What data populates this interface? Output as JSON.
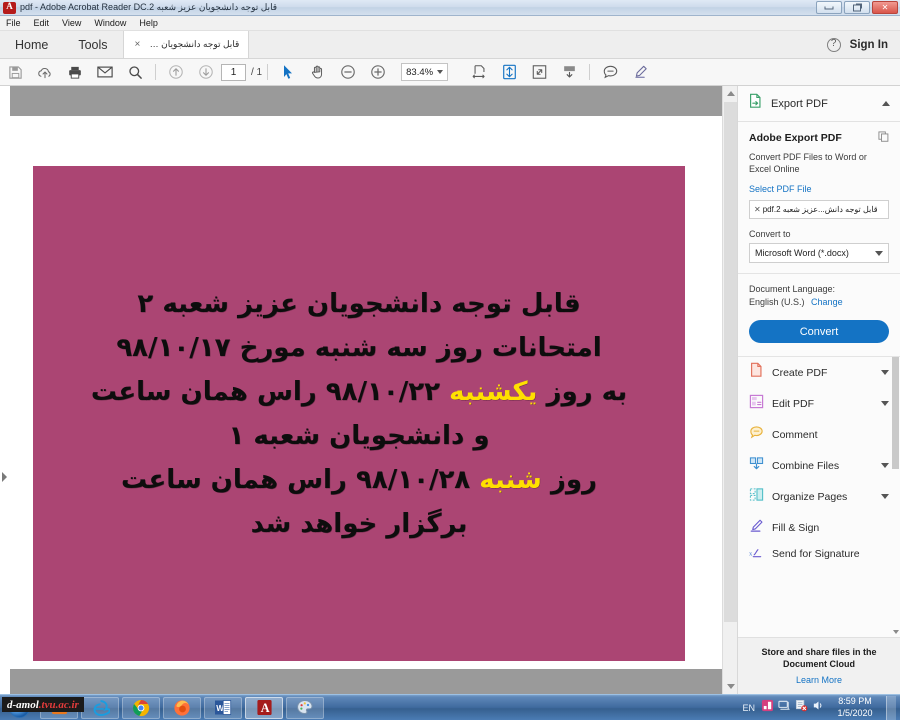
{
  "window": {
    "title": "قابل توجه دانشجویان عزیز شعبه 2.pdf - Adobe Acrobat Reader DC",
    "app_icon": "acrobat-icon",
    "minimize_label": "Minimize",
    "maximize_label": "Restore",
    "close_label": "Close"
  },
  "menubar": {
    "items": [
      {
        "label": "File"
      },
      {
        "label": "Edit"
      },
      {
        "label": "View"
      },
      {
        "label": "Window"
      },
      {
        "label": "Help"
      }
    ]
  },
  "tabbar": {
    "home_label": "Home",
    "tools_label": "Tools",
    "document_tab": "قابل توجه دانشجویان عز...",
    "document_tab_close": "×",
    "help_icon": "help-circle-icon",
    "signin_label": "Sign In"
  },
  "toolbar": {
    "save_label": "Save",
    "cloud_label": "Save to cloud",
    "print_label": "Print",
    "email_label": "Email",
    "search_label": "Find",
    "page_up_label": "Previous page",
    "page_down_label": "Next page",
    "page_current": "1",
    "page_total": "/ 1",
    "select_label": "Select tool",
    "hand_label": "Hand tool",
    "zoom_out_label": "Zoom out",
    "zoom_in_label": "Zoom in",
    "zoom_value": "83.4%",
    "fit_width_label": "Fit width",
    "fit_page_label": "Fit page",
    "fullscreen_label": "Zoom to page level",
    "scroll_mode_label": "Scroll mode",
    "comment_label": "Add comment",
    "highlight_label": "Highlight text"
  },
  "document": {
    "lines": [
      {
        "segments": [
          {
            "text": "قابل توجه دانشجویان عزیز شعبه ۲",
            "highlight": false
          }
        ]
      },
      {
        "segments": [
          {
            "text": "امتحانات روز سه شنبه مورخ ۹۸/۱۰/۱۷",
            "highlight": false
          }
        ]
      },
      {
        "segments": [
          {
            "text": "به روز ",
            "highlight": false
          },
          {
            "text": "یکشنبه",
            "highlight": true
          },
          {
            "text": " ۹۸/۱۰/۲۲ راس همان ساعت",
            "highlight": false
          }
        ]
      },
      {
        "segments": [
          {
            "text": "و دانشجویان شعبه ۱",
            "highlight": false
          }
        ]
      },
      {
        "segments": [
          {
            "text": "روز ",
            "highlight": false
          },
          {
            "text": "شنبه",
            "highlight": true
          },
          {
            "text": " ۹۸/۱۰/۲۸ راس همان ساعت",
            "highlight": false
          }
        ]
      },
      {
        "segments": [
          {
            "text": "برگزار خواهد شد",
            "highlight": false
          }
        ]
      }
    ],
    "background_color": "#ab4573",
    "text_color": "#0d0d0d",
    "highlight_color": "#ffe000"
  },
  "right_panel": {
    "header_title": "Export PDF",
    "header_icon": "export-pdf-icon",
    "collapse_icon": "chevron-up-icon",
    "export": {
      "heading": "Adobe Export PDF",
      "copy_icon": "copy-icon",
      "description": "Convert PDF Files to Word or Excel Online",
      "select_file_link": "Select PDF File",
      "file_chip": "قابل توجه دانش...عزیز شعبه 2.pdf",
      "file_chip_close": "✕",
      "convert_to_label": "Convert to",
      "convert_to_value": "Microsoft Word (*.docx)",
      "language_label": "Document Language:",
      "language_value": "English (U.S.)",
      "language_change_link": "Change",
      "convert_button": "Convert",
      "convert_button_color": "#1473c4"
    },
    "tools": [
      {
        "label": "Create PDF",
        "icon": "create-pdf-icon",
        "has_chevron": true
      },
      {
        "label": "Edit PDF",
        "icon": "edit-pdf-icon",
        "has_chevron": true
      },
      {
        "label": "Comment",
        "icon": "comment-icon",
        "has_chevron": false
      },
      {
        "label": "Combine Files",
        "icon": "combine-files-icon",
        "has_chevron": true
      },
      {
        "label": "Organize Pages",
        "icon": "organize-pages-icon",
        "has_chevron": true
      },
      {
        "label": "Send for Signature",
        "icon": "send-signature-icon",
        "has_chevron": false
      }
    ],
    "fill_sign_label": "Fill & Sign",
    "footer_text": "Store and share files in the Document Cloud",
    "footer_link": "Learn More"
  },
  "taskbar": {
    "start_label": "Start",
    "tooltip": {
      "prefix": "d-amol",
      "suffix": ".tvu.ac.ir"
    },
    "apps": [
      {
        "name": "media-player-icon"
      },
      {
        "name": "internet-explorer-icon"
      },
      {
        "name": "chrome-icon"
      },
      {
        "name": "firefox-icon"
      },
      {
        "name": "word-icon"
      },
      {
        "name": "acrobat-icon"
      },
      {
        "name": "paint-icon"
      }
    ],
    "tray": {
      "language": "EN",
      "time": "8:59 PM",
      "date": "1/5/2020"
    }
  }
}
